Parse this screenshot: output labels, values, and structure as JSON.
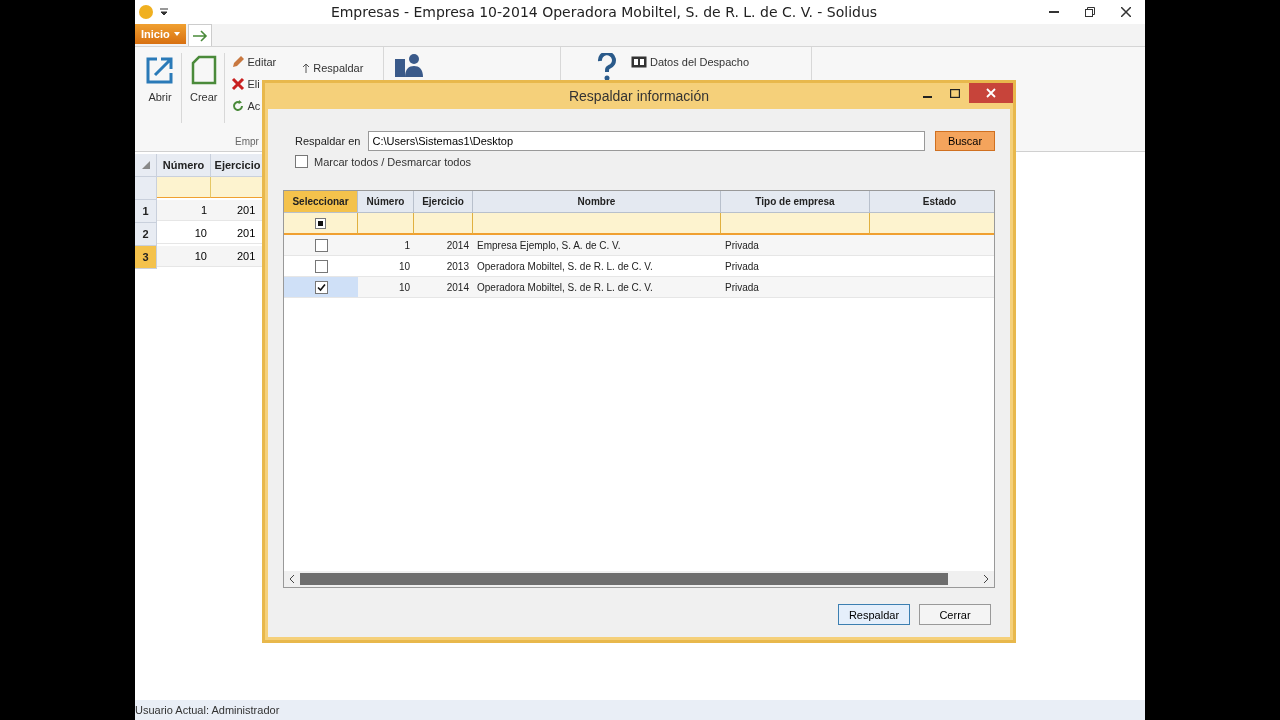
{
  "window": {
    "title": "Empresas - Empresa 10-2014 Operadora Mobiltel, S. de R. L. de C. V. - Solidus"
  },
  "ribbon": {
    "app_tab": "Inicio",
    "large_buttons": [
      {
        "label": "Abrir",
        "kind": "open"
      },
      {
        "label": "Crear",
        "kind": "new"
      }
    ],
    "small_buttons": [
      {
        "label": "Editar",
        "kind": "edit"
      },
      {
        "label": "Eli",
        "kind": "delete"
      },
      {
        "label": "Ac",
        "kind": "refresh"
      }
    ],
    "backup_button": "Respaldar",
    "group_label": "Empr",
    "office_data_button": "Datos del Despacho"
  },
  "companies_table": {
    "columns": [
      "Número",
      "Ejercicio"
    ],
    "rows": [
      {
        "index": "1",
        "numero": "1",
        "ejercicio": "201",
        "selected": false
      },
      {
        "index": "2",
        "numero": "10",
        "ejercicio": "201",
        "selected": false
      },
      {
        "index": "3",
        "numero": "10",
        "ejercicio": "201",
        "selected": true
      }
    ]
  },
  "dialog": {
    "title": "Respaldar información",
    "path_label": "Respaldar en",
    "path_value": "C:\\Users\\Sistemas1\\Desktop",
    "browse_button": "Buscar",
    "toggle_all": {
      "label": "Marcar todos / Desmarcar todos",
      "checked": false
    },
    "filter_checkbox": {
      "indeterminate": true
    },
    "columns": [
      "Seleccionar",
      "Número",
      "Ejercicio",
      "Nombre",
      "Tipo de empresa",
      "Estado"
    ],
    "rows": [
      {
        "checked": false,
        "selected": false,
        "numero": "1",
        "ejercicio": "2014",
        "nombre": "Empresa Ejemplo, S. A. de C. V.",
        "tipo": "Privada"
      },
      {
        "checked": false,
        "selected": false,
        "numero": "10",
        "ejercicio": "2013",
        "nombre": "Operadora Mobiltel, S. de R. L. de C. V.",
        "tipo": "Privada"
      },
      {
        "checked": true,
        "selected": true,
        "numero": "10",
        "ejercicio": "2014",
        "nombre": "Operadora Mobiltel, S. de R. L. de C. V.",
        "tipo": "Privada"
      }
    ],
    "buttons": [
      "Respaldar",
      "Cerrar"
    ]
  },
  "status_bar": "Usuario Actual: Administrador"
}
